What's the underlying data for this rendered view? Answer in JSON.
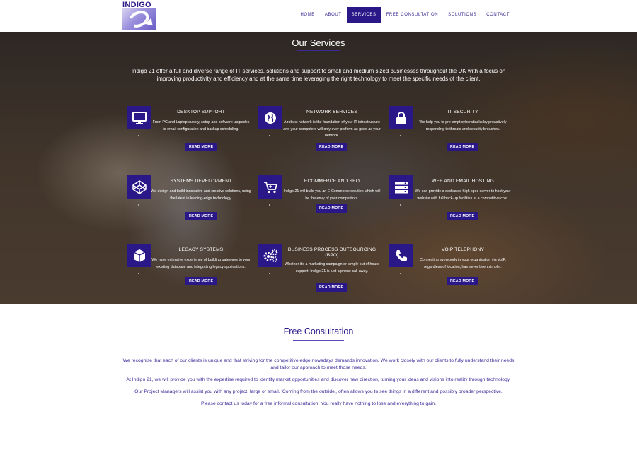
{
  "header": {
    "logo_text": "INDIGO",
    "nav": [
      {
        "label": "HOME"
      },
      {
        "label": "ABOUT"
      },
      {
        "label": "SERVICES"
      },
      {
        "label": "FREE CONSULTATION"
      },
      {
        "label": "SOLUTIONS"
      },
      {
        "label": "CONTACT"
      }
    ],
    "active": "SERVICES"
  },
  "services_section": {
    "title": "Our Services",
    "intro": "Indigo 21 offer a full and diverse range of IT services, solutions and support to small and medium sized businesses throughout the UK with a focus on improving productivity and efficiency and at the same time leveraging the right technology to meet the specific needs of the client.",
    "read_more": "READ MORE",
    "items": [
      {
        "title": "DESKTOP SUPPORT",
        "icon": "monitor-icon",
        "desc": "From PC and Laptop supply, setup and software upgrades to email configuration and backup scheduling."
      },
      {
        "title": "NETWORK SERVICES",
        "icon": "globe-icon",
        "desc": "A robust network is the foundation of your IT infrastructure and your computers will only ever perform as good as your network."
      },
      {
        "title": "IT SECURITY",
        "icon": "lock-icon",
        "desc": "We help you to pre-empt cyberattacks by proactively responding to threats and security breaches."
      },
      {
        "title": "SYSTEMS DEVELOPMENT",
        "icon": "codepen-icon",
        "desc": "We design and build innovative and creative solutions, using the latest in leading-edge technology."
      },
      {
        "title": "ECOMMERCE AND SEO",
        "icon": "cart-icon",
        "desc": "Indigo 21 will build you an E-Commerce solution which will be the envy of your competitors."
      },
      {
        "title": "WEB AND EMAIL HOSTING",
        "icon": "server-icon",
        "desc": "We can provide a dedicated high spec server to host your website with full back-up facilities at a competitive cost."
      },
      {
        "title": "LEGACY SYSTEMS",
        "icon": "cube-icon",
        "desc": "We have extensive experience of building gateways to your existing database and integrating legacy applications."
      },
      {
        "title": "BUSINESS PROCESS OUTSOURCING (BPO)",
        "icon": "cogs-icon",
        "desc": "Whether it's a marketing campaign or simply out of hours support, Indigo 21 is just a phone call away."
      },
      {
        "title": "VOIP TELEPHONY",
        "icon": "phone-icon",
        "desc": "Connecting everybody in your organisation via VoIP, regardless of location, has never been simpler."
      }
    ]
  },
  "consultation": {
    "title": "Free Consultation",
    "paragraphs": [
      "We recognise that each of our clients is unique and that striving for the competitive edge nowadays demands innovation. We work closely with our clients to fully understand their needs and tailor our approach to meet those needs.",
      "At Indigo 21, we will provide you with the expertise required to identify market opportunities and discover new direction, turning your ideas and visions into reality through technology.",
      "Our Project Managers will assist you with any project, large or small. 'Coming from the outside', often allows you to see things in a different and possibly broader perspective.",
      "Please contact us today for a free informal consultation. You really have nothing to lose and everything to gain."
    ]
  },
  "colors": {
    "accent": "#2a1788",
    "text_indigo": "#3b2f9a"
  }
}
